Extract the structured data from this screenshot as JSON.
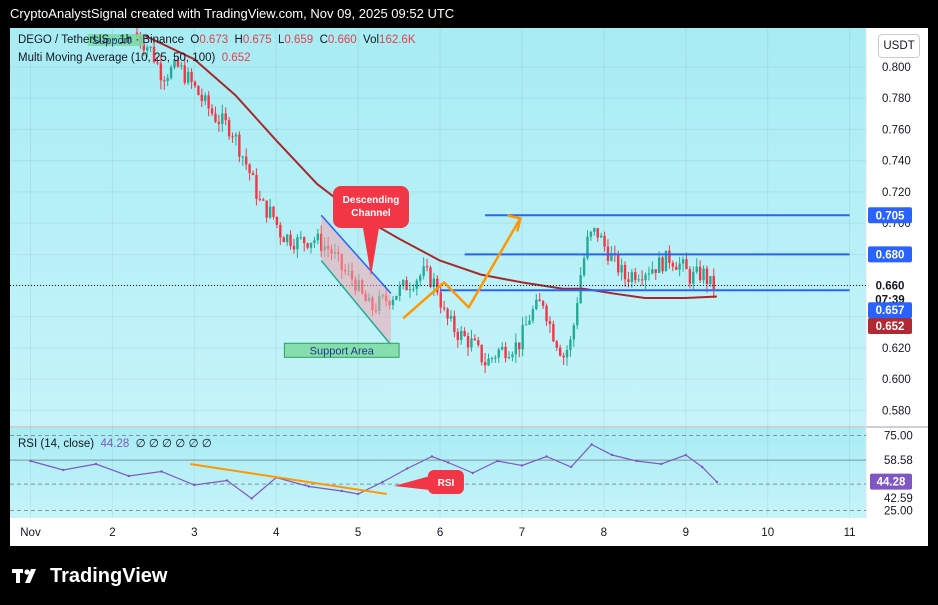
{
  "header": {
    "caption": "CryptoAnalystSignal created with TradingView.com, Nov 09, 2025 09:52 UTC"
  },
  "legend": {
    "symbol": "DEGO / TetherUS · 1h · Binance",
    "open_label": "O",
    "open": "0.673",
    "high_label": "H",
    "high": "0.675",
    "low_label": "L",
    "low": "0.659",
    "close_label": "C",
    "close": "0.660",
    "vol_label": "Vol",
    "vol": "162.6K",
    "ma_label": "Multi Moving Average (10, 25, 50, 100)",
    "ma_value": "0.652",
    "rsi_label": "RSI (14, close)",
    "rsi_value": "44.28",
    "rsi_extra": "∅ ∅ ∅ ∅ ∅ ∅"
  },
  "currency_button": "USDT",
  "annotations": {
    "descending_channel": "Descending Channel",
    "support_area": "Support Area",
    "support_top": "Support",
    "rsi_callout": "RSI"
  },
  "price_badges": {
    "last": "0.660",
    "countdown": "07:39",
    "line_657": "0.657",
    "ma": "0.652",
    "res_680": "0.680",
    "res_705": "0.705"
  },
  "rsi_badges": {
    "upper": "75.00",
    "mid": "58.58",
    "current": "44.28",
    "lower": "42.59",
    "bottom": "25.00"
  },
  "footer": {
    "brand": "TradingView"
  },
  "colors": {
    "chart_bg_top": "#a8ecf4",
    "chart_bg_bottom": "#c6f4fa",
    "up": "#22ab94",
    "down": "#f23645",
    "ma_line": "#a52a2a",
    "blue_line": "#2962ff",
    "orange": "#ff9800",
    "rsi_line": "#7e57c2",
    "badge_blue": "#2962ff",
    "badge_ma": "#b22833"
  },
  "chart_data": [
    {
      "type": "candlestick",
      "symbol": "DEGO / TetherUS",
      "interval": "1h",
      "y_axis": {
        "ticks": [
          0.58,
          0.6,
          0.62,
          0.64,
          0.66,
          0.68,
          0.7,
          0.72,
          0.74,
          0.76,
          0.78,
          0.8
        ],
        "range": [
          0.57,
          0.825
        ]
      },
      "y_tick_labels": [
        "0.580",
        "0.600",
        "0.620",
        "0.640",
        "0.660",
        "0.680",
        "0.700",
        "0.720",
        "0.740",
        "0.760",
        "0.780",
        "0.800"
      ],
      "x_axis": {
        "labels": [
          "Nov",
          "2",
          "3",
          "4",
          "5",
          "6",
          "7",
          "8",
          "9",
          "10",
          "11"
        ],
        "range_days": [
          0.75,
          11.2
        ]
      },
      "price_path": [
        [
          2.3,
          0.822
        ],
        [
          2.5,
          0.812
        ],
        [
          2.65,
          0.795
        ],
        [
          2.85,
          0.8
        ],
        [
          3.0,
          0.79
        ],
        [
          3.15,
          0.778
        ],
        [
          3.3,
          0.768
        ],
        [
          3.5,
          0.76
        ],
        [
          3.7,
          0.735
        ],
        [
          3.85,
          0.712
        ],
        [
          4.0,
          0.705
        ],
        [
          4.1,
          0.693
        ],
        [
          4.3,
          0.688
        ],
        [
          4.5,
          0.69
        ],
        [
          4.7,
          0.683
        ],
        [
          4.85,
          0.67
        ],
        [
          5.0,
          0.663
        ],
        [
          5.1,
          0.652
        ],
        [
          5.2,
          0.645
        ],
        [
          5.35,
          0.65
        ],
        [
          5.5,
          0.655
        ],
        [
          5.7,
          0.663
        ],
        [
          5.85,
          0.668
        ],
        [
          6.0,
          0.66
        ],
        [
          6.1,
          0.64
        ],
        [
          6.25,
          0.63
        ],
        [
          6.45,
          0.622
        ],
        [
          6.6,
          0.61
        ],
        [
          6.75,
          0.618
        ],
        [
          7.0,
          0.622
        ],
        [
          7.15,
          0.642
        ],
        [
          7.3,
          0.65
        ],
        [
          7.4,
          0.632
        ],
        [
          7.55,
          0.615
        ],
        [
          7.65,
          0.625
        ],
        [
          7.75,
          0.665
        ],
        [
          7.85,
          0.69
        ],
        [
          7.95,
          0.695
        ],
        [
          8.05,
          0.685
        ],
        [
          8.2,
          0.673
        ],
        [
          8.3,
          0.665
        ],
        [
          8.4,
          0.668
        ],
        [
          8.55,
          0.67
        ],
        [
          8.7,
          0.673
        ],
        [
          8.85,
          0.678
        ],
        [
          9.0,
          0.672
        ],
        [
          9.1,
          0.665
        ],
        [
          9.25,
          0.668
        ],
        [
          9.35,
          0.66
        ]
      ],
      "moving_average": [
        [
          2.4,
          0.82
        ],
        [
          3.0,
          0.805
        ],
        [
          3.5,
          0.782
        ],
        [
          4.0,
          0.753
        ],
        [
          4.5,
          0.725
        ],
        [
          5.0,
          0.705
        ],
        [
          5.5,
          0.69
        ],
        [
          6.0,
          0.676
        ],
        [
          6.5,
          0.667
        ],
        [
          7.0,
          0.662
        ],
        [
          7.5,
          0.658
        ],
        [
          7.75,
          0.658
        ],
        [
          8.1,
          0.655
        ],
        [
          8.5,
          0.652
        ],
        [
          9.0,
          0.652
        ],
        [
          9.38,
          0.653
        ]
      ],
      "horizontal_levels": [
        {
          "value": 0.705,
          "from": 6.55,
          "to": 11.0,
          "label": "0.705"
        },
        {
          "value": 0.68,
          "from": 6.3,
          "to": 11.0,
          "label": "0.680"
        },
        {
          "value": 0.657,
          "from": 6.0,
          "to": 11.0,
          "label": "0.657"
        }
      ],
      "last_price": 0.66,
      "ma_value": 0.652
    },
    {
      "type": "line",
      "name": "RSI (14, close)",
      "y_axis": {
        "ticks": [
          25.0,
          42.59,
          58.58,
          75.0
        ],
        "range": [
          20,
          80
        ]
      },
      "levels": [
        75.0,
        58.58,
        42.59,
        25.0
      ],
      "current": 44.28,
      "x": [
        1.0,
        1.4,
        1.8,
        2.2,
        2.6,
        3.0,
        3.4,
        3.7,
        4.0,
        4.4,
        4.8,
        5.0,
        5.3,
        5.6,
        5.9,
        6.1,
        6.4,
        6.7,
        7.0,
        7.3,
        7.6,
        7.85,
        8.1,
        8.4,
        8.7,
        9.0,
        9.2,
        9.38
      ],
      "values": [
        58,
        52,
        56,
        48,
        51,
        42,
        45,
        33,
        47,
        41,
        38,
        36,
        44,
        53,
        61,
        57,
        50,
        58,
        55,
        61,
        54,
        69,
        62,
        58,
        56,
        62,
        54,
        44
      ]
    }
  ]
}
